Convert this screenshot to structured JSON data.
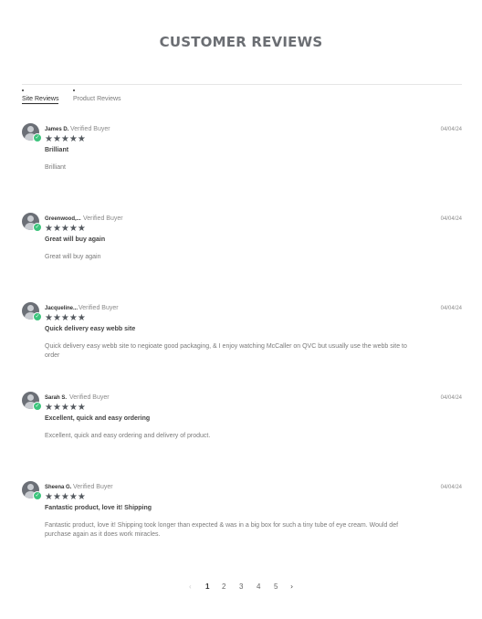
{
  "page": {
    "title": "CUSTOMER REVIEWS"
  },
  "tabs": [
    {
      "label": "Site Reviews",
      "active": true
    },
    {
      "label": "Product Reviews",
      "active": false
    }
  ],
  "reviews": [
    {
      "name": "James D.",
      "verified": "Verified Buyer",
      "date": "04/04/24",
      "stars": "★★★★★",
      "rating": 5,
      "headline": "Brilliant",
      "body": "Brilliant"
    },
    {
      "name": "Greenwood,...",
      "verified": "Verified Buyer",
      "date": "04/04/24",
      "stars": "★★★★★",
      "rating": 5,
      "headline": "Great will buy again",
      "body": "Great will buy again"
    },
    {
      "name": "Jacqueline...",
      "verified": "Verified Buyer",
      "date": "04/04/24",
      "stars": "★★★★★",
      "rating": 5,
      "headline": "Quick delivery easy webb site",
      "body": "Quick delivery easy webb site to negioate good packaging, & I enjoy watching McCaller on QVC but usually use the webb site to order"
    },
    {
      "name": "Sarah S.",
      "verified": "Verified Buyer",
      "date": "04/04/24",
      "stars": "★★★★★",
      "rating": 5,
      "headline": "Excellent, quick and easy ordering",
      "body": "Excellent, quick and easy ordering and delivery of product."
    },
    {
      "name": "Sheena G.",
      "verified": "Verified Buyer",
      "date": "04/04/24",
      "stars": "★★★★★",
      "rating": 5,
      "headline": "Fantastic product, love it! Shipping",
      "body": "Fantastic product, love it! Shipping took longer than expected & was in a big box for such a tiny tube of eye cream. Would def purchase again as it does work miracles."
    }
  ],
  "pagination": {
    "prev": "‹",
    "pages": [
      "1",
      "2",
      "3",
      "4",
      "5"
    ],
    "current": "1",
    "next": "›"
  },
  "colors": {
    "verified_badge": "#3cc47c",
    "title": "#6b6e73",
    "stars": "#555a60"
  }
}
